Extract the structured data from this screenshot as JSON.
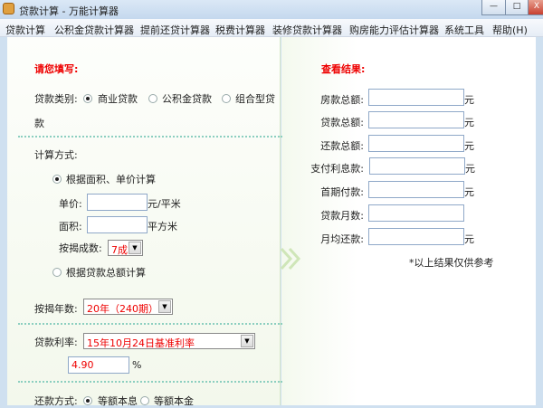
{
  "window": {
    "title": "贷款计算 - 万能计算器",
    "minimize": "—",
    "maximize": "□",
    "close": "X"
  },
  "menu": [
    "贷款计算",
    "公积金贷款计算器",
    "提前还贷计算器",
    "税费计算器",
    "装修贷款计算器",
    "购房能力评估计算器",
    "系统工具",
    "帮助(H)"
  ],
  "form": {
    "heading": "请您填写:",
    "loan_type_label": "贷款类别:",
    "loan_types": [
      "商业贷款",
      "公积金贷款",
      "组合型贷",
      "款"
    ],
    "calc_method_label": "计算方式:",
    "method_area": "根据面积、单价计算",
    "unit_price_label": "单价:",
    "unit_price_value": "",
    "unit_price_unit": "元/平米",
    "area_label": "面积:",
    "area_value": "",
    "area_unit": "平方米",
    "ratio_label": "按揭成数:",
    "ratio_value": "7成",
    "method_total": "根据贷款总额计算",
    "years_label": "按揭年数:",
    "years_value": "20年（240期）",
    "rate_label": "贷款利率:",
    "rate_value": "15年10月24日基准利率",
    "rate_input": "4.90",
    "rate_unit": "%",
    "repay_label": "还款方式:",
    "repay_options": [
      "等额本息",
      "等额本金"
    ]
  },
  "results": {
    "heading": "查看结果:",
    "rows": [
      {
        "label": "房款总额:",
        "value": "",
        "unit": "元"
      },
      {
        "label": "贷款总额:",
        "value": "",
        "unit": "元"
      },
      {
        "label": "还款总额:",
        "value": "",
        "unit": "元"
      },
      {
        "label": "支付利息款:",
        "value": "",
        "unit": "元"
      },
      {
        "label": "首期付款:",
        "value": "",
        "unit": "元"
      },
      {
        "label": "贷款月数:",
        "value": "",
        "unit": ""
      },
      {
        "label": "月均还款:",
        "value": "",
        "unit": "元"
      }
    ],
    "note": "*以上结果仅供参考"
  }
}
